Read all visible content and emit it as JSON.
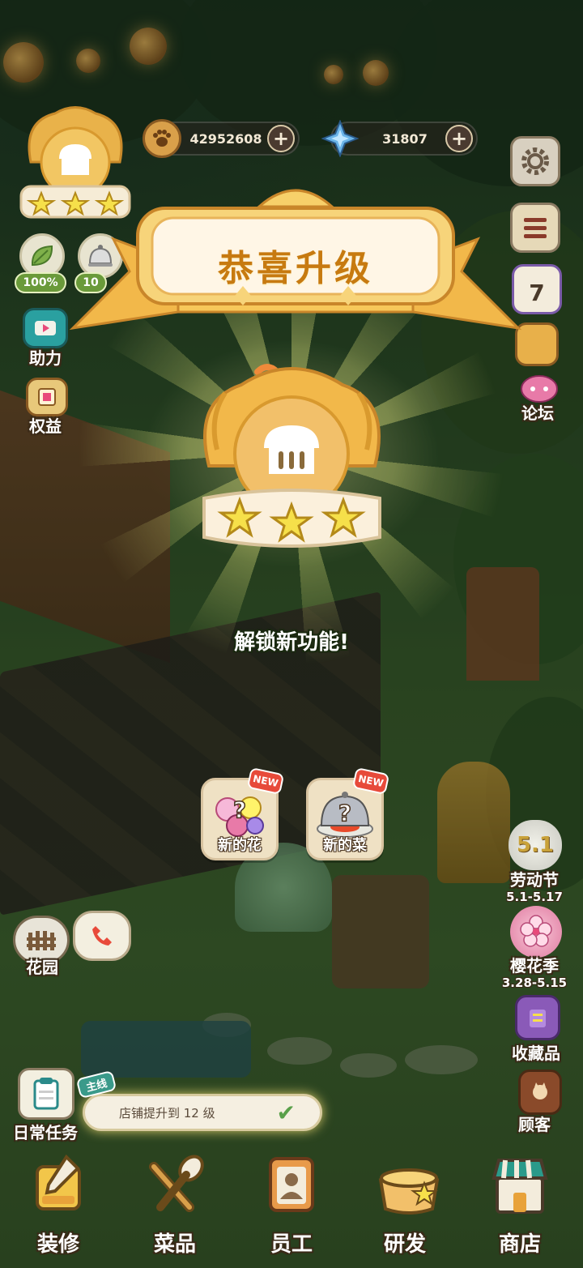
{
  "currency": {
    "paw_coins": "42952608",
    "diamonds": "31807"
  },
  "stats": {
    "left_percent": "100%",
    "right_percent": "10"
  },
  "sidebar_left": {
    "assist": "助力",
    "benefits": "权益",
    "garden": "花园",
    "daily_tasks": "日常任务"
  },
  "sidebar_right": {
    "calendar_day": "7",
    "forum": "论坛",
    "labor_day": {
      "label": "劳动节",
      "date": "5.1-5.17",
      "icon_text": "5.1"
    },
    "sakura": {
      "label": "樱花季",
      "date": "3.28-5.15"
    },
    "collection": "收藏品",
    "customers": "顾客"
  },
  "modal": {
    "title": "恭喜升级",
    "unlock_text": "解锁新功能!",
    "unlocks": [
      {
        "label": "新的花",
        "tag": "NEW"
      },
      {
        "label": "新的菜",
        "tag": "NEW"
      }
    ]
  },
  "quest": {
    "tag": "主线",
    "text": "店铺提升到 12 级"
  },
  "bottom_nav": [
    {
      "label": "装修"
    },
    {
      "label": "菜品"
    },
    {
      "label": "员工"
    },
    {
      "label": "研发"
    },
    {
      "label": "商店"
    }
  ],
  "colors": {
    "banner_gold": "#f4c65a",
    "title_orange": "#c77a10",
    "star_yellow": "#f6e04a",
    "new_red": "#e74a3a"
  }
}
